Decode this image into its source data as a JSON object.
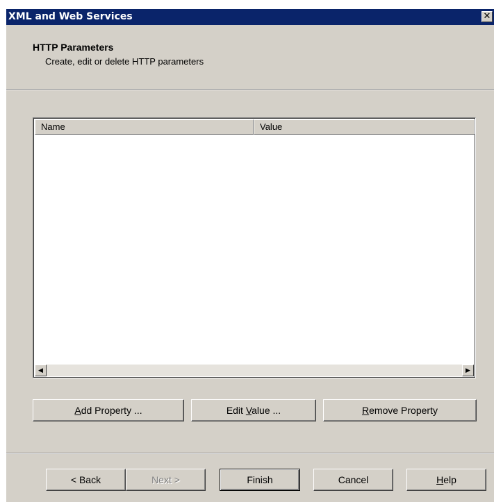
{
  "window": {
    "title": "XML and Web Services",
    "close_glyph": "✕"
  },
  "header": {
    "title": "HTTP Parameters",
    "subtitle": "Create, edit or delete HTTP parameters"
  },
  "table": {
    "columns": [
      "Name",
      "Value"
    ],
    "rows": [],
    "scroll_left_glyph": "◀",
    "scroll_right_glyph": "▶"
  },
  "actions": {
    "add_accel": "A",
    "add_rest": "dd Property ...",
    "edit_pre": "Edit ",
    "edit_accel": "V",
    "edit_rest": "alue ...",
    "remove_accel": "R",
    "remove_rest": "emove Property"
  },
  "nav": {
    "back": "< Back",
    "next": "Next >",
    "finish": "Finish",
    "cancel": "Cancel",
    "help_accel": "H",
    "help_rest": "elp"
  }
}
